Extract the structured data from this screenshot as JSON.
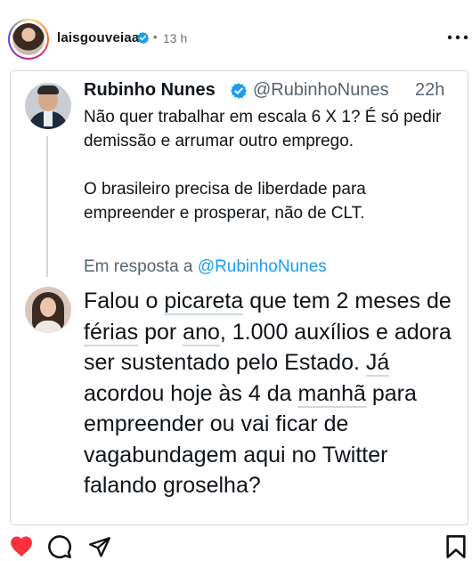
{
  "post": {
    "username": "laisgouveiaa",
    "separator": "•",
    "time": "13 h",
    "more_icon": "more-horizontal-icon"
  },
  "tweet": {
    "name": "Rubinho Nunes",
    "handle": "@RubinhoNunes",
    "time": "22h",
    "paragraph1": "Não quer trabalhar em escala 6 X 1? É só pedir demissão e arrumar outro emprego.",
    "paragraph2": "O brasileiro precisa de liberdade para empreender e prosperar, não de CLT."
  },
  "reply": {
    "prefix": "Em resposta a ",
    "mention": "@RubinhoNunes",
    "segments": {
      "s1": "Falou o ",
      "u1": "picareta",
      "s2": " que tem 2 meses de ",
      "u2": "férias",
      "s3": " por ",
      "u3": "ano",
      "s4": ", 1.000 auxílios e adora ser sustentado pelo Estado. ",
      "u4": "Já",
      "s5": " acordou hoje às 4 da ",
      "u5": "manhã",
      "s6": " para empreender ou vai ficar de vagabundagem aqui no Twitter falando groselha?"
    }
  },
  "actions": {
    "like_icon": "heart-icon",
    "comment_icon": "comment-icon",
    "share_icon": "share-icon",
    "save_icon": "bookmark-icon"
  },
  "colors": {
    "like_red": "#ff3040",
    "verified_blue": "#1d9bf0",
    "mention_blue": "#1d9bf0",
    "secondary_text": "#536471"
  }
}
